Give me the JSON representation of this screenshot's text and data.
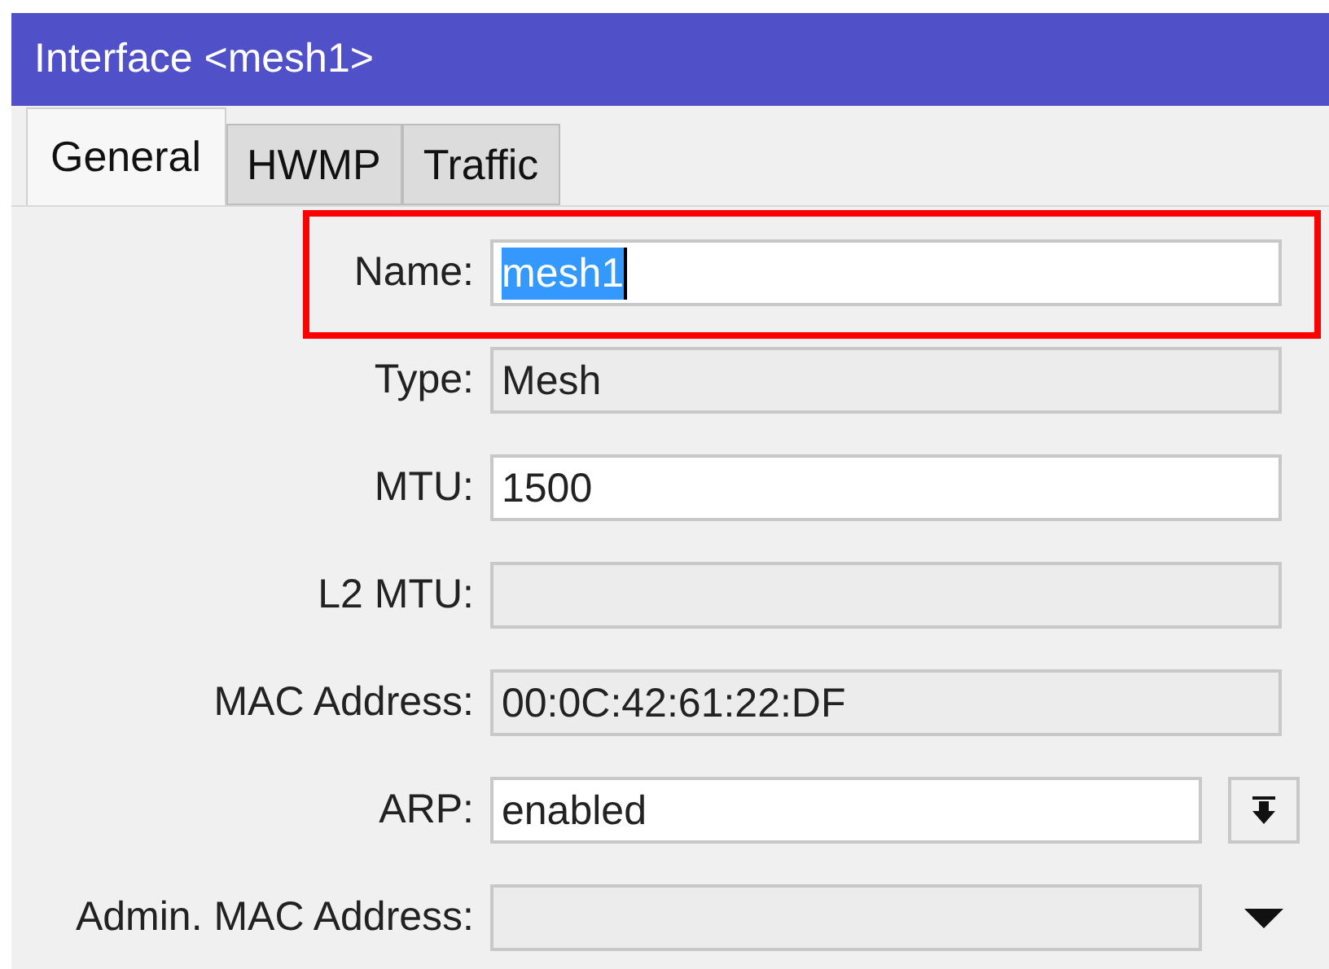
{
  "window": {
    "title": "Interface <mesh1>"
  },
  "tabs": [
    {
      "label": "General",
      "selected": true
    },
    {
      "label": "HWMP",
      "selected": false
    },
    {
      "label": "Traffic",
      "selected": false
    }
  ],
  "fields": [
    {
      "label": "Name:",
      "value": "mesh1",
      "kind": "text",
      "text_selected": true,
      "highlighted": true
    },
    {
      "label": "Type:",
      "value": "Mesh",
      "kind": "readonly",
      "text_selected": false,
      "highlighted": false
    },
    {
      "label": "MTU:",
      "value": "1500",
      "kind": "text",
      "text_selected": false,
      "highlighted": false
    },
    {
      "label": "L2 MTU:",
      "kind": "readonly",
      "text_selected": false,
      "highlighted": false
    },
    {
      "label": "MAC Address:",
      "value": "00:0C:42:61:22:DF",
      "kind": "readonly",
      "text_selected": false,
      "highlighted": false
    },
    {
      "label": "ARP:",
      "value": "enabled",
      "kind": "select",
      "text_selected": false,
      "highlighted": false
    },
    {
      "label": "Admin. MAC Address:",
      "kind": "readonly_select",
      "text_selected": false,
      "highlighted": false
    }
  ]
}
